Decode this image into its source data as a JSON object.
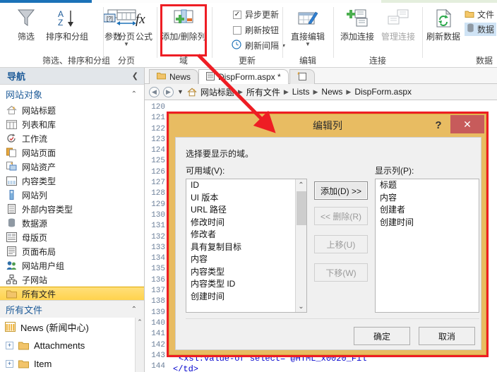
{
  "ribbon": {
    "groups": [
      {
        "label": "筛选、排序和分组"
      },
      {
        "label": "分页"
      },
      {
        "label": "域"
      },
      {
        "label": "更新"
      },
      {
        "label": "编辑"
      },
      {
        "label": "连接"
      },
      {
        "label": "数据"
      }
    ],
    "buttons": {
      "filter": "筛选",
      "sort_group": "排序和分组",
      "parameters": "参数",
      "formula": "公式",
      "paging": "分页",
      "add_remove_columns": "添加/删除列",
      "async_update": "异步更新",
      "refresh_button": "刷新按钮",
      "refresh_interval": "刷新间隔",
      "direct_edit": "直接编辑",
      "add_connection": "添加连接",
      "manage_connection": "管理连接",
      "refresh_data": "刷新数据",
      "file": "文件",
      "data": "数据"
    }
  },
  "nav": {
    "header_title": "导航",
    "collapse_icon": "chevron-left-icon",
    "section_title": "网站对象",
    "items": [
      {
        "label": "网站标题",
        "icon": "home-icon"
      },
      {
        "label": "列表和库",
        "icon": "table-icon"
      },
      {
        "label": "工作流",
        "icon": "workflow-icon"
      },
      {
        "label": "网站页面",
        "icon": "pages-icon"
      },
      {
        "label": "网站资产",
        "icon": "assets-icon"
      },
      {
        "label": "内容类型",
        "icon": "content-type-icon"
      },
      {
        "label": "网站列",
        "icon": "column-icon"
      },
      {
        "label": "外部内容类型",
        "icon": "external-content-icon"
      },
      {
        "label": "数据源",
        "icon": "database-icon"
      },
      {
        "label": "母版页",
        "icon": "master-page-icon"
      },
      {
        "label": "页面布局",
        "icon": "page-layout-icon"
      },
      {
        "label": "网站用户组",
        "icon": "users-icon"
      },
      {
        "label": "子网站",
        "icon": "subsite-icon"
      },
      {
        "label": "所有文件",
        "icon": "folder-icon",
        "selected": true
      }
    ],
    "files_header": "所有文件",
    "files": [
      {
        "label": "News (新闻中心)",
        "icon": "list-icon",
        "expandable": false
      },
      {
        "label": "Attachments",
        "icon": "folder-icon",
        "expandable": true,
        "expander": "+"
      },
      {
        "label": "Item",
        "icon": "folder-icon",
        "expandable": true,
        "expander": "+"
      }
    ]
  },
  "editor": {
    "tabs": [
      {
        "label": "News",
        "icon": "folder-icon",
        "active": false
      },
      {
        "label": "DispForm.aspx *",
        "icon": "page-icon",
        "active": true
      },
      {
        "label": "",
        "icon": "new-page-icon",
        "active": false
      }
    ],
    "breadcrumb": [
      "网站标题",
      "所有文件",
      "Lists",
      "News",
      "DispForm.aspx"
    ],
    "line_numbers": [
      120,
      121,
      122,
      123,
      124,
      125,
      126,
      127,
      128,
      129,
      130,
      131,
      132,
      133,
      134,
      135,
      136,
      137,
      138,
      139,
      140,
      141,
      142,
      143,
      144
    ],
    "code_snippet": "<xsl:value-of select=\"@HTML_x0020_Fil",
    "code_snippet2": "</td>"
  },
  "dialog": {
    "title": "编辑列",
    "help_icon": "question-mark-icon",
    "close_icon": "close-icon",
    "instruction": "选择要显示的域。",
    "available_label": "可用域(V):",
    "displayed_label": "显示列(P):",
    "available_items": [
      "ID",
      "UI 版本",
      "URL 路径",
      "修改时间",
      "修改者",
      "具有复制目标",
      "内容",
      "内容类型",
      "内容类型 ID",
      "创建时间"
    ],
    "displayed_items": [
      "标题",
      "内容",
      "创建者",
      "创建时间"
    ],
    "mid_buttons": [
      {
        "label": "添加(D)  >>",
        "disabled": false,
        "primary": true
      },
      {
        "label": "<<  删除(R)",
        "disabled": true,
        "primary": false
      },
      {
        "label": "上移(U)",
        "disabled": true,
        "primary": false
      },
      {
        "label": "下移(W)",
        "disabled": true,
        "primary": false
      }
    ],
    "ok_label": "确定",
    "cancel_label": "取消"
  },
  "colors": {
    "highlight_red": "#ee1d24",
    "dialog_gold": "#e8bc62",
    "accent_blue": "#1b72b8",
    "selection_yellow": "#ffd34d",
    "close_red": "#c75b5b"
  }
}
